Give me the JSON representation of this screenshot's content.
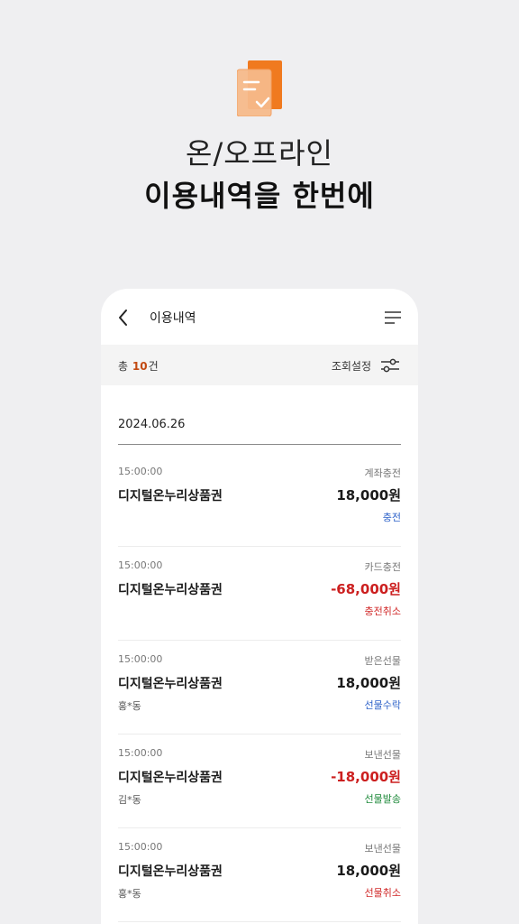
{
  "headline": {
    "line1": "온/오프라인",
    "line2": "이용내역을 한번에"
  },
  "colors": {
    "accent": "#f07a1f",
    "negative": "#cc1f1f",
    "status_blue": "#2f63c9",
    "status_red": "#d12a2a",
    "status_green": "#1f8a3b"
  },
  "icons": {
    "hero": "document-check-icon",
    "back": "chevron-left-icon",
    "menu": "menu-lines-icon",
    "filter": "filter-sliders-icon"
  },
  "topbar": {
    "title": "이용내역"
  },
  "summary": {
    "total_prefix": "총",
    "total_count": "10",
    "total_suffix": "건",
    "settings_label": "조회설정"
  },
  "date_group": "2024.06.26",
  "transactions": [
    {
      "time": "15:00:00",
      "type": "계좌충전",
      "name": "디지털온누리상품권",
      "amount": "18,000원",
      "negative": false,
      "person": "",
      "status": "충전",
      "status_color": "blue"
    },
    {
      "time": "15:00:00",
      "type": "카드충전",
      "name": "디지털온누리상품권",
      "amount": "-68,000원",
      "negative": true,
      "person": "",
      "status": "충전취소",
      "status_color": "red"
    },
    {
      "time": "15:00:00",
      "type": "받은선물",
      "name": "디지털온누리상품권",
      "amount": "18,000원",
      "negative": false,
      "person": "홍*동",
      "status": "선물수락",
      "status_color": "blue"
    },
    {
      "time": "15:00:00",
      "type": "보낸선물",
      "name": "디지털온누리상품권",
      "amount": "-18,000원",
      "negative": true,
      "person": "김*동",
      "status": "선물발송",
      "status_color": "green"
    },
    {
      "time": "15:00:00",
      "type": "보낸선물",
      "name": "디지털온누리상품권",
      "amount": "18,000원",
      "negative": false,
      "person": "홍*동",
      "status": "선물취소",
      "status_color": "red"
    }
  ]
}
